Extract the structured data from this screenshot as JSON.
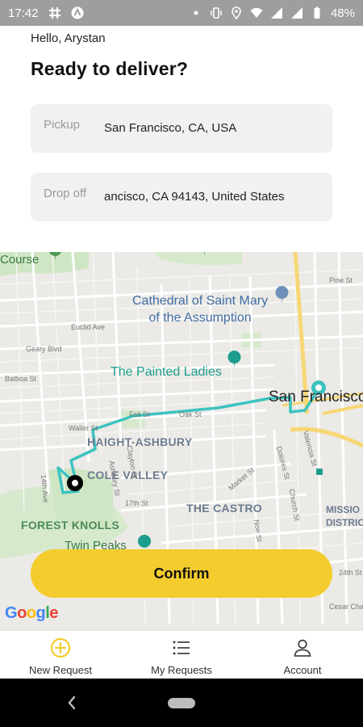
{
  "status_bar": {
    "time": "17:42",
    "battery": "48%",
    "left_icons": [
      "slack-icon",
      "app-icon"
    ],
    "right_icons": [
      "dot-icon",
      "vibrate-icon",
      "location-icon",
      "wifi-icon",
      "signal-icon",
      "signal-icon",
      "battery-icon"
    ]
  },
  "header": {
    "greeting": "Hello, Arystan",
    "headline": "Ready to deliver?"
  },
  "pickup": {
    "label": "Pickup",
    "value": "San Francisco, CA, USA"
  },
  "dropoff": {
    "label": "Drop off",
    "value": "ancisco, CA 94143, United States"
  },
  "map": {
    "labels": {
      "course": "Course",
      "cathedral": "Cathedral of Saint Mary\nof the Assumption",
      "painted_ladies": "The Painted Ladies",
      "city": "San Francisco",
      "haight": "HAIGHT-ASHBURY",
      "cole": "COLE VALLEY",
      "castro": "THE CASTRO",
      "mission": "MISSIO\nDISTRIC",
      "forest": "FOREST KNOLLS",
      "twin": "Twin Peaks"
    },
    "streets": [
      "Euclid Ave",
      "Geary Blvd",
      "Balboa St",
      "Fell St",
      "Oak St",
      "Pine St",
      "Market St",
      "17th St",
      "Valencia St",
      "Dolores St",
      "Noe St",
      "Church St",
      "Clayton St",
      "Ashbury St",
      "Waller St",
      "14th Ave",
      "24th St",
      "Cesar Chavez"
    ],
    "google": "Google",
    "route_color": "#3cc3c0",
    "accent_yellow": "#f4cc2d"
  },
  "confirm_button": "Confirm",
  "bottom_nav": [
    {
      "label": "New Request",
      "icon": "plus-circle-icon",
      "color": "#f4cc2d"
    },
    {
      "label": "My Requests",
      "icon": "list-icon",
      "color": "#333333"
    },
    {
      "label": "Account",
      "icon": "person-icon",
      "color": "#333333"
    }
  ]
}
